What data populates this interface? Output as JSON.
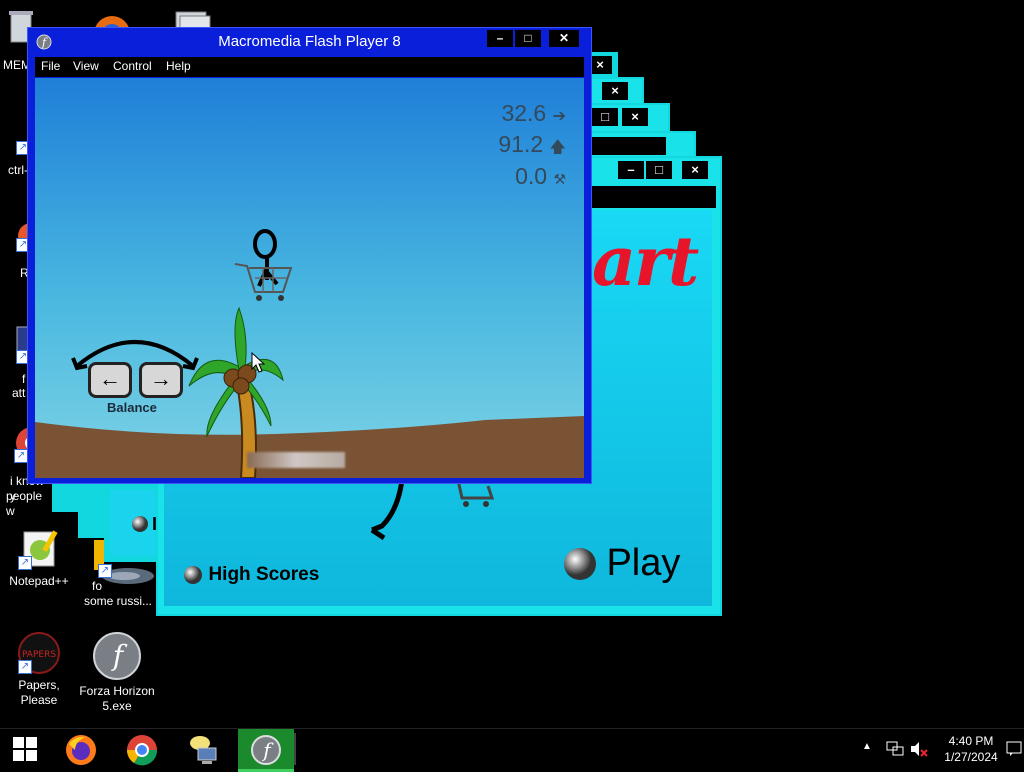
{
  "desktop": {
    "icons": {
      "notepadpp": "Notepad++",
      "papers_please": "Papers, Please",
      "forza": "Forza Horizon 5.exe",
      "partial_ctrl": "ctrl-",
      "partial_r": "R",
      "partial_f": "f",
      "partial_att": "att",
      "partial_i_know": "i know y",
      "partial_people": "people w",
      "partial_mem": "MEM",
      "partial_fo": "fo",
      "partial_some_russi": "some russi..."
    }
  },
  "bg_window": {
    "close_glyph": "×",
    "buttons": {
      "play": "Play",
      "high_scores": "High Scores",
      "partial_menu": "I"
    },
    "logo_partial": "art"
  },
  "flash_window": {
    "title": "Macromedia Flash Player 8",
    "controls": {
      "minimize": "–",
      "maximize": "□",
      "close": "✕"
    },
    "menu": {
      "file": "File",
      "view": "View",
      "control": "Control",
      "help": "Help"
    },
    "hud": {
      "distance": "32.6",
      "height": "91.2",
      "score": "0.0",
      "distance_icon": "arrow-right-icon",
      "height_icon": "arrow-up-icon",
      "score_icon": "tilt-icon"
    },
    "balance_label": "Balance",
    "left_key": "←",
    "right_key": "→"
  },
  "taskbar": {
    "time": "4:40 PM",
    "date": "1/27/2024"
  },
  "colors": {
    "flash_title": "#0a1fd9",
    "cyan_window": "#19e2e8",
    "sky": "#1f7fd8"
  }
}
